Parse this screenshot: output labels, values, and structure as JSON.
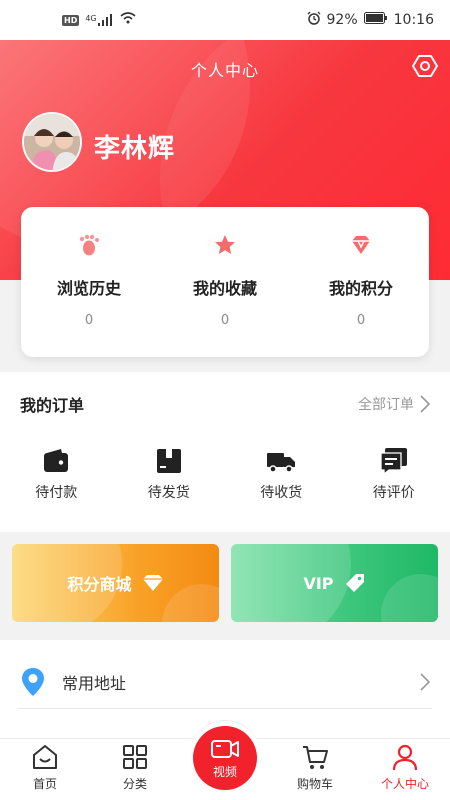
{
  "status_bar": {
    "network_badge": "HD",
    "signal_label": "4G",
    "battery": "92%",
    "time": "10:16"
  },
  "header": {
    "title": "个人中心",
    "username": "李林辉"
  },
  "stats": [
    {
      "label": "浏览历史",
      "value": "0",
      "icon": "footprint-icon"
    },
    {
      "label": "我的收藏",
      "value": "0",
      "icon": "star-icon"
    },
    {
      "label": "我的积分",
      "value": "0",
      "icon": "diamond-icon"
    }
  ],
  "orders": {
    "title": "我的订单",
    "all_label": "全部订单",
    "items": [
      {
        "label": "待付款",
        "icon": "wallet-icon"
      },
      {
        "label": "待发货",
        "icon": "box-icon"
      },
      {
        "label": "待收货",
        "icon": "truck-icon"
      },
      {
        "label": "待评价",
        "icon": "review-icon"
      }
    ]
  },
  "promos": {
    "points_mall": "积分商城",
    "vip": "VIP"
  },
  "address": {
    "label": "常用地址"
  },
  "tabbar": {
    "items": [
      {
        "label": "首页",
        "icon": "home-icon"
      },
      {
        "label": "分类",
        "icon": "category-icon"
      },
      {
        "label": "视频",
        "icon": "video-icon"
      },
      {
        "label": "购物车",
        "icon": "cart-icon"
      },
      {
        "label": "个人中心",
        "icon": "person-icon"
      }
    ],
    "active_index": 4
  },
  "colors": {
    "brand_red": "#f2222c",
    "points_orange": "#f9a227",
    "vip_green": "#3ec77e"
  }
}
